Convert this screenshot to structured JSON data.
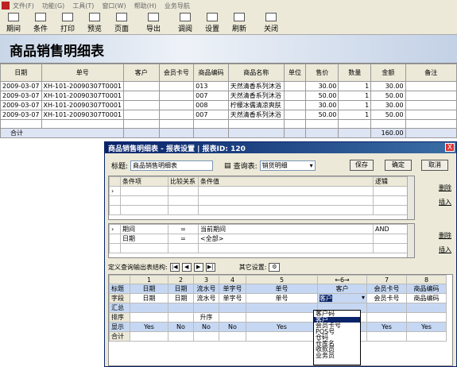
{
  "menu": [
    "文件(F)",
    "功能(G)",
    "工具(T)",
    "窗口(W)",
    "帮助(H)",
    "业务导航"
  ],
  "toolbar": [
    "期间",
    "条件",
    "打印",
    "预览",
    "页面",
    "导出",
    "调阅",
    "设置",
    "刷新",
    "关闭"
  ],
  "page_title": "商品销售明细表",
  "grid": {
    "headers": [
      "日期",
      "单号",
      "客户",
      "会员卡号",
      "商品编码",
      "商品名称",
      "单位",
      "售价",
      "数量",
      "金额",
      "备注"
    ],
    "rows": [
      [
        "2009-03-07",
        "XH-101-20090307T0001",
        "",
        "",
        "013",
        "天然清香系列沐浴",
        "",
        "30.00",
        "1",
        "30.00",
        ""
      ],
      [
        "2009-03-07",
        "XH-101-20090307T0001",
        "",
        "",
        "007",
        "天然清香系列沐浴",
        "",
        "50.00",
        "1",
        "50.00",
        ""
      ],
      [
        "2009-03-07",
        "XH-101-20090307T0001",
        "",
        "",
        "008",
        "柠檬冰儒清凉爽肤",
        "",
        "30.00",
        "1",
        "30.00",
        ""
      ],
      [
        "2009-03-07",
        "XH-101-20090307T0001",
        "",
        "",
        "007",
        "天然清香系列沐浴",
        "",
        "50.00",
        "1",
        "50.00",
        ""
      ]
    ],
    "total_label": "合计",
    "total_amount": "160.00"
  },
  "dialog": {
    "title": "商品销售明细表 - 报表设置 | 报表ID: 120",
    "close": "X",
    "title_label": "标题:",
    "title_value": "商品销售明细表",
    "query_label": "查询表:",
    "query_value": "销货明细",
    "save": "保存",
    "ok": "确定",
    "cancel": "取消",
    "cond_headers": [
      "条件项",
      "比较关系",
      "条件值",
      "逻辑"
    ],
    "delete": "删除",
    "insert": "插入",
    "cond2_rows": [
      [
        "期间",
        "=",
        "当前期间",
        "AND"
      ],
      [
        "日期",
        "=",
        "<全部>",
        ""
      ]
    ],
    "struct_label": "定义查询输出表结构:",
    "other_label": "其它设置:",
    "nav": [
      "|◀",
      "◀",
      "▶",
      "▶|"
    ],
    "col_nums": [
      "1",
      "2",
      "3",
      "4",
      "5",
      "←6→",
      "7",
      "8"
    ],
    "struct_rows": [
      {
        "label": "标题",
        "cells": [
          "日期",
          "日期",
          "流水号",
          "单字号",
          "单号",
          "客户",
          "会员卡号",
          "商品编码"
        ]
      },
      {
        "label": "字段",
        "cells": [
          "日期",
          "日期",
          "流水号",
          "单字号",
          "单号",
          "客户",
          "会员卡号",
          "商品编码"
        ]
      },
      {
        "label": "汇总",
        "cells": [
          "",
          "",
          "",
          "",
          "",
          "",
          "",
          ""
        ]
      },
      {
        "label": "排序",
        "cells": [
          "",
          "",
          "升序",
          "",
          "",
          "",
          "",
          ""
        ]
      },
      {
        "label": "显示",
        "cells": [
          "Yes",
          "No",
          "No",
          "No",
          "Yes",
          "",
          "Yes",
          "Yes"
        ]
      },
      {
        "label": "合计",
        "cells": [
          "",
          "",
          "",
          "",
          "",
          "",
          "",
          ""
        ]
      }
    ],
    "dropdown": [
      "客户码",
      "客户",
      "会员卡号",
      "POS号",
      "仓码",
      "仓库名",
      "收款员",
      "业务员"
    ]
  }
}
